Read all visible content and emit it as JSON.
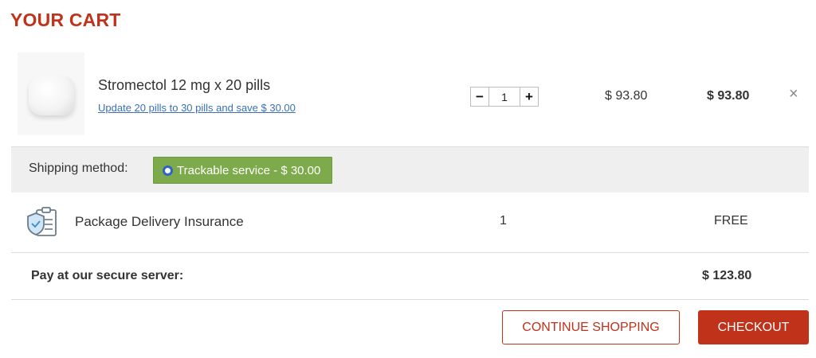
{
  "cart": {
    "title": "YOUR CART"
  },
  "product": {
    "name": "Stromectol 12 mg x 20 pills",
    "upgrade_link": "Update 20 pills to 30 pills and save $ 30.00",
    "quantity": "1",
    "qty_minus_label": "−",
    "qty_plus_label": "+",
    "unit_price": "$ 93.80",
    "total_price": "$ 93.80",
    "remove_label": "×",
    "image_icon": "pill-image"
  },
  "shipping": {
    "label": "Shipping method:",
    "option": "Trackable service - $ 30.00",
    "option_color": "#7daa4b"
  },
  "insurance": {
    "icon": "shield-clipboard-icon",
    "label": "Package Delivery Insurance",
    "quantity": "1",
    "price": "FREE"
  },
  "total": {
    "label": "Pay at our secure server:",
    "amount": "$ 123.80"
  },
  "actions": {
    "continue_label": "CONTINUE SHOPPING",
    "checkout_label": "CHECKOUT"
  },
  "colors": {
    "brand": "#c0321a",
    "link": "#3b6fb6",
    "shipping_bg": "#efefef"
  }
}
